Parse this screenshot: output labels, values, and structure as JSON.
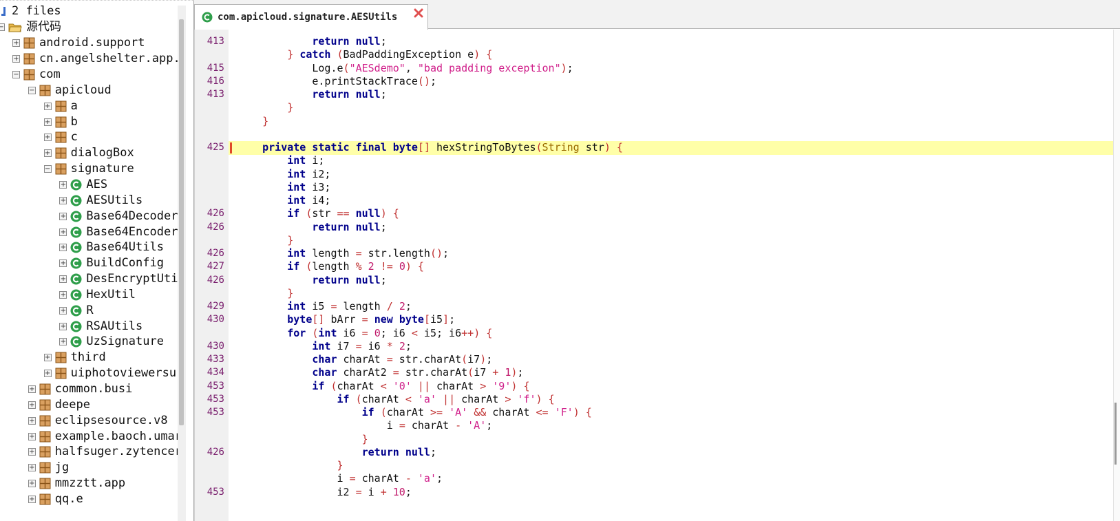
{
  "tree": {
    "header_label": "2 files",
    "root_label": "源代码",
    "items": [
      {
        "label": "android.support",
        "kind": "package"
      },
      {
        "label": "cn.angelshelter.app.",
        "kind": "package"
      },
      {
        "label": "com",
        "kind": "package"
      },
      {
        "label": "apicloud",
        "kind": "package"
      },
      {
        "label": "a",
        "kind": "package"
      },
      {
        "label": "b",
        "kind": "package"
      },
      {
        "label": "c",
        "kind": "package"
      },
      {
        "label": "dialogBox",
        "kind": "package"
      },
      {
        "label": "signature",
        "kind": "package"
      },
      {
        "label": "AES",
        "kind": "class"
      },
      {
        "label": "AESUtils",
        "kind": "class"
      },
      {
        "label": "Base64Decoder",
        "kind": "class"
      },
      {
        "label": "Base64Encoder",
        "kind": "class"
      },
      {
        "label": "Base64Utils",
        "kind": "class"
      },
      {
        "label": "BuildConfig",
        "kind": "class"
      },
      {
        "label": "DesEncryptUti",
        "kind": "class"
      },
      {
        "label": "HexUtil",
        "kind": "class"
      },
      {
        "label": "R",
        "kind": "class"
      },
      {
        "label": "RSAUtils",
        "kind": "class"
      },
      {
        "label": "UzSignature",
        "kind": "class"
      },
      {
        "label": "third",
        "kind": "package"
      },
      {
        "label": "uiphotoviewersu",
        "kind": "package"
      },
      {
        "label": "common.busi",
        "kind": "package"
      },
      {
        "label": "deepe",
        "kind": "package"
      },
      {
        "label": "eclipsesource.v8",
        "kind": "package"
      },
      {
        "label": "example.baoch.umar",
        "kind": "package"
      },
      {
        "label": "halfsuger.zytencer",
        "kind": "package"
      },
      {
        "label": "jg",
        "kind": "package"
      },
      {
        "label": "mmzztt.app",
        "kind": "package"
      },
      {
        "label": "qq.e",
        "kind": "package"
      }
    ]
  },
  "editor": {
    "tab_title": "com.apicloud.signature.AESUtils",
    "tab_icon": "class-icon",
    "close_icon": "close-icon",
    "colors": {
      "keyword": "#00008b",
      "string": "#d01f8a",
      "line_number": "#7a1f6e",
      "current_line": "#ffffa8"
    },
    "line_numbers": [
      "413",
      "",
      "415",
      "416",
      "413",
      "",
      "",
      "",
      "425",
      "",
      "",
      "",
      "",
      "426",
      "426",
      "",
      "426",
      "427",
      "426",
      "",
      "429",
      "430",
      "",
      "430",
      "433",
      "434",
      "453",
      "453",
      "453",
      "",
      "",
      "426",
      "",
      "",
      "453"
    ],
    "code_lines": [
      "            return null;",
      "        } catch (BadPaddingException e) {",
      "            Log.e(\"AESdemo\", \"bad padding exception\");",
      "            e.printStackTrace();",
      "            return null;",
      "        }",
      "    }",
      "",
      "    private static final byte[] hexStringToBytes(String str) {",
      "        int i;",
      "        int i2;",
      "        int i3;",
      "        int i4;",
      "        if (str == null) {",
      "            return null;",
      "        }",
      "        int length = str.length();",
      "        if (length % 2 != 0) {",
      "            return null;",
      "        }",
      "        int i5 = length / 2;",
      "        byte[] bArr = new byte[i5];",
      "        for (int i6 = 0; i6 < i5; i6++) {",
      "            int i7 = i6 * 2;",
      "            char charAt = str.charAt(i7);",
      "            char charAt2 = str.charAt(i7 + 1);",
      "            if (charAt < '0' || charAt > '9') {",
      "                if (charAt < 'a' || charAt > 'f') {",
      "                    if (charAt >= 'A' && charAt <= 'F') {",
      "                        i = charAt - 'A';",
      "                    }",
      "                    return null;",
      "                }",
      "                i = charAt - 'a';",
      "                i2 = i + 10;"
    ]
  }
}
